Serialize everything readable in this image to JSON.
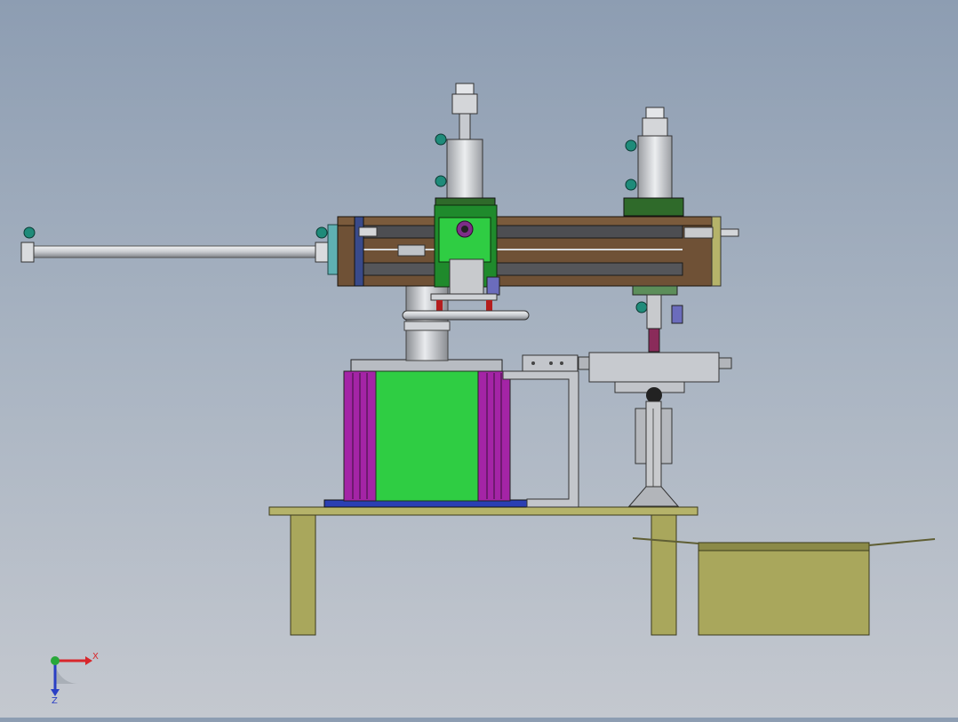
{
  "view": {
    "background_top": "#8d9db2",
    "background_bottom": "#c4c8cf"
  },
  "triad": {
    "x_label": "X",
    "z_label": "Z",
    "x_color": "#d8262b",
    "y_color": "#29a83a",
    "z_color": "#2a3fc4"
  },
  "palette": {
    "table": "#a9a75c",
    "rail_wood": "#6f5136",
    "steel": "#bfc3c8",
    "green_block": "#2fcd43",
    "magenta": "#a424a6",
    "teal_fitting": "#1f8b7a",
    "dark_green": "#2f6a2a"
  }
}
